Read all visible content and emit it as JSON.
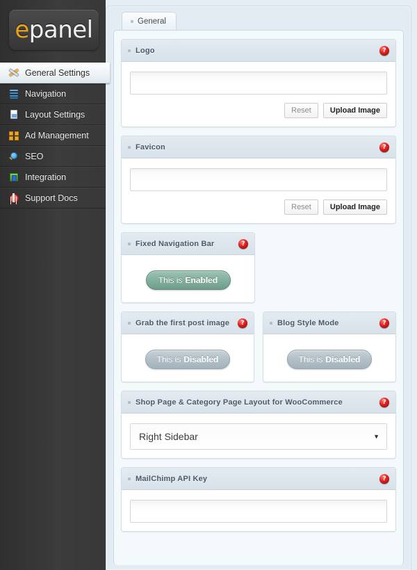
{
  "logo": {
    "accent_char": "e",
    "rest": "panel",
    "accent_color": "#e8a21c"
  },
  "sidebar": {
    "items": [
      {
        "label": "General Settings",
        "icon": "tools-icon",
        "active": true
      },
      {
        "label": "Navigation",
        "icon": "lines-icon",
        "active": false
      },
      {
        "label": "Layout Settings",
        "icon": "document-icon",
        "active": false
      },
      {
        "label": "Ad Management",
        "icon": "grid-squares-icon",
        "active": false
      },
      {
        "label": "SEO",
        "icon": "magnifier-icon",
        "active": false
      },
      {
        "label": "Integration",
        "icon": "integration-icon",
        "active": false
      },
      {
        "label": "Support Docs",
        "icon": "compass-icon",
        "active": false
      }
    ]
  },
  "tabs": [
    {
      "label": "General",
      "active": true
    }
  ],
  "help_glyph": "?",
  "panels": {
    "logo": {
      "title": "Logo",
      "value": "",
      "reset_label": "Reset",
      "upload_label": "Upload Image"
    },
    "favicon": {
      "title": "Favicon",
      "value": "",
      "reset_label": "Reset",
      "upload_label": "Upload Image"
    },
    "fixed_nav": {
      "title": "Fixed Navigation Bar",
      "toggle_lead": "This is",
      "toggle_state": "Enabled",
      "enabled": true
    },
    "grab_image": {
      "title": "Grab the first post image",
      "toggle_lead": "This is",
      "toggle_state": "Disabled",
      "enabled": false
    },
    "blog_style": {
      "title": "Blog Style Mode",
      "toggle_lead": "This is",
      "toggle_state": "Disabled",
      "enabled": false
    },
    "woo_layout": {
      "title": "Shop Page & Category Page Layout for WooCommerce",
      "selected": "Right Sidebar",
      "caret": "▼"
    },
    "mailchimp": {
      "title": "MailChimp API Key",
      "value": ""
    }
  }
}
